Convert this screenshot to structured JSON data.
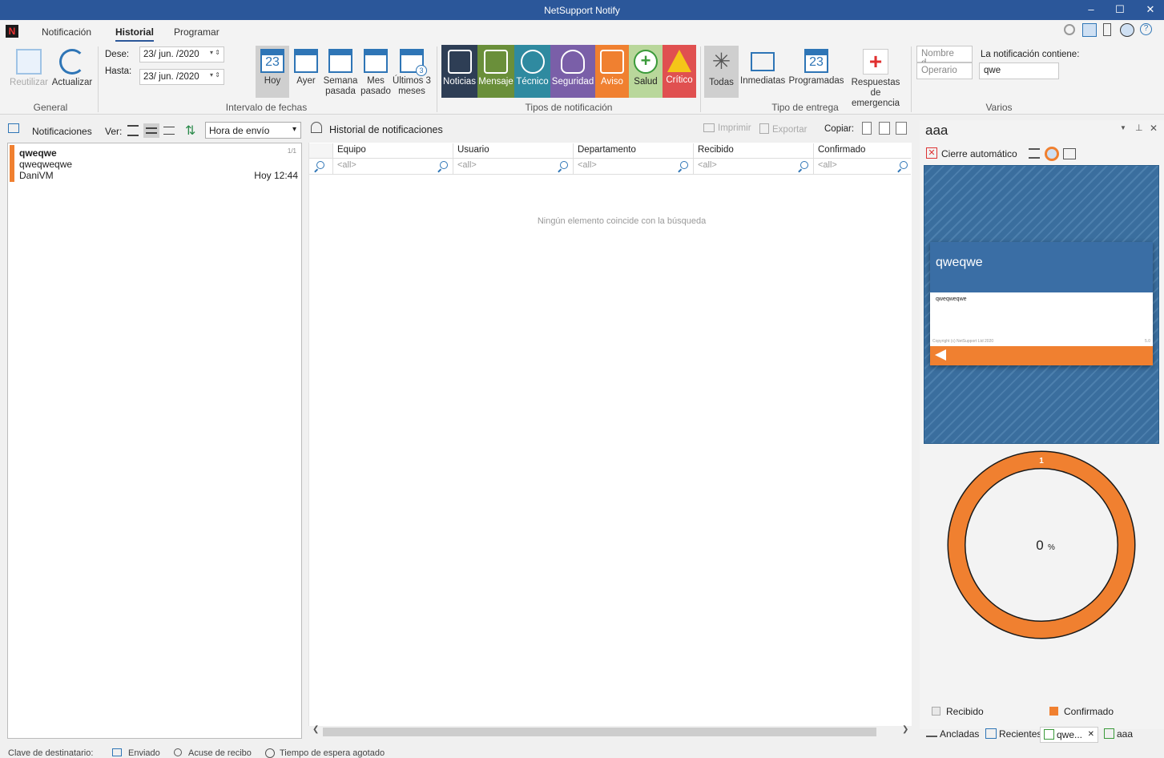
{
  "window": {
    "title": "NetSupport Notify",
    "min": "–",
    "max": "☐",
    "close": "✕"
  },
  "tabs": [
    {
      "label": "Notificación"
    },
    {
      "label": "Historial"
    },
    {
      "label": "Programar"
    }
  ],
  "ribbon": {
    "general": {
      "label": "General",
      "reuse": "Reutilizar",
      "refresh": "Actualizar"
    },
    "dates": {
      "label": "Intervalo de fechas",
      "from_label": "Dese:",
      "from_value": "23/ jun. /2020",
      "to_label": "Hasta:",
      "to_value": "23/ jun. /2020",
      "today": "Hoy",
      "today_num": "23",
      "yesterday": "Ayer",
      "lastweek": "Semana pasada",
      "lastmonth": "Mes pasado",
      "last3": "Últimos 3 meses",
      "last3_num": "3"
    },
    "types": {
      "label": "Tipos de notificación",
      "items": [
        {
          "label": "Noticias",
          "color": "#2e3e55"
        },
        {
          "label": "Mensaje",
          "color": "#6a8f3a"
        },
        {
          "label": "Técnico",
          "color": "#2f8aa0"
        },
        {
          "label": "Seguridad",
          "color": "#7a5fa8"
        },
        {
          "label": "Aviso",
          "color": "#f08030"
        },
        {
          "label": "Salud",
          "color": "#b9d79b"
        },
        {
          "label": "Crítico",
          "color": "#e05050"
        }
      ]
    },
    "delivery": {
      "label": "Tipo de entrega",
      "all": "Todas",
      "immediate": "Inmediatas",
      "scheduled": "Programadas",
      "scheduled_num": "23",
      "emergency": "Respuestas de emergencia"
    },
    "misc": {
      "label": "Varios",
      "name_placeholder": "Nombre d...",
      "operator_placeholder": "Operario",
      "contains_label": "La notificación contiene:",
      "contains_value": "qwe"
    }
  },
  "left": {
    "header": "Notificaciones",
    "view_label": "Ver:",
    "sort_value": "Hora de envío",
    "items": [
      {
        "title": "qweqwe",
        "body": "qweqweqwe",
        "sender": "DaniVM",
        "time": "Hoy 12:44",
        "count": "1/1"
      }
    ]
  },
  "middle": {
    "title": "Historial de notificaciones",
    "print": "Imprimir",
    "export": "Exportar",
    "copy": "Copiar:",
    "columns": [
      "Equipo",
      "Usuario",
      "Departamento",
      "Recibido",
      "Confirmado"
    ],
    "filter": "<all>",
    "empty": "Ningún elemento coincide con la búsqueda"
  },
  "right": {
    "title": "aaa",
    "autoclose": "Cierre automático",
    "card": {
      "title": "qweqwe",
      "body": "qweqweqwe",
      "copyright": "Copyright (c) NetSupport Ltd 2020",
      "version": "5.0"
    },
    "donut": {
      "count": "1",
      "percent": "0",
      "unit": "%",
      "received_fraction": 0,
      "confirmed_fraction": 1
    },
    "legend": {
      "received": "Recibido",
      "confirmed": "Confirmado"
    },
    "bottom_tabs": [
      {
        "label": "Ancladas"
      },
      {
        "label": "Recientes"
      },
      {
        "label": "qwe..."
      },
      {
        "label": "aaa"
      }
    ]
  },
  "status": {
    "key": "Clave de destinatario:",
    "sent": "Enviado",
    "receipt": "Acuse de recibo",
    "timeout": "Tiempo de espera agotado"
  }
}
